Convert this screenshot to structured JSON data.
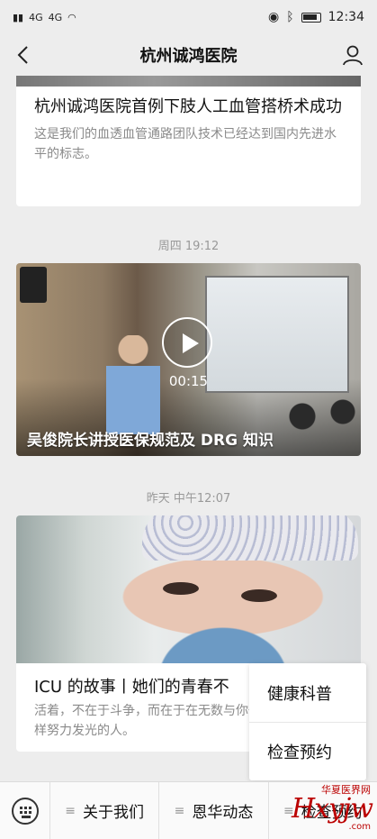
{
  "status_bar": {
    "left_signal_1": "4G",
    "left_signal_2": "4G",
    "time": "12:34"
  },
  "nav": {
    "title": "杭州诚鸿医院"
  },
  "article1": {
    "title": "杭州诚鸿医院首例下肢人工血管搭桥术成功",
    "desc": "这是我们的血透血管通路团队技术已经达到国内先进水平的标志。"
  },
  "timestamp1": "周四 19:12",
  "video": {
    "duration": "00:15",
    "title": "吴俊院长讲授医保规范及 DRG 知识"
  },
  "timestamp2": "昨天 中午12:07",
  "article2": {
    "title": "ICU 的故事丨她们的青春不",
    "desc": "活着，不在于斗争，而在于在无数与你一样努力发光的人。"
  },
  "popup_menu": {
    "items": [
      "健康科普",
      "检查预约"
    ]
  },
  "bottom_menu": {
    "items": [
      "关于我们",
      "恩华动态",
      "检查预约"
    ]
  },
  "watermark": {
    "cn": "华夏医界网",
    "en": "Hxyjw",
    "com": ".com"
  },
  "icons": {
    "back": "back-arrow-icon",
    "user": "user-icon",
    "keyboard": "keyboard-icon",
    "play": "play-icon"
  }
}
